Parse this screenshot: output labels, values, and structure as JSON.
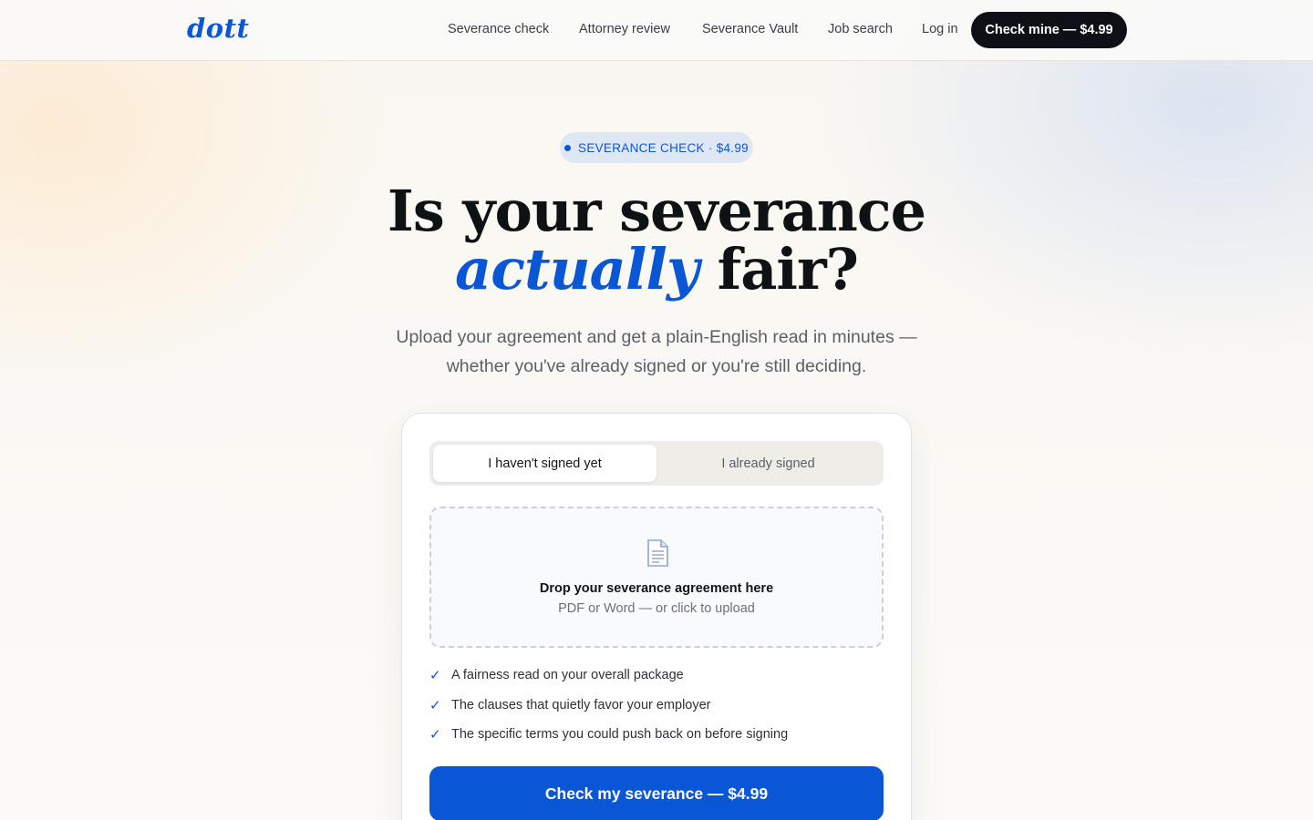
{
  "brand": {
    "logo": "dott"
  },
  "nav": {
    "links": [
      "Severance check",
      "Attorney review",
      "Severance Vault",
      "Job search",
      "Log in"
    ],
    "cta": "Check mine — $4.99"
  },
  "hero": {
    "pill": "SEVERANCE CHECK · $4.99",
    "title_line1": "Is your severance",
    "title_accent": "actually",
    "title_rest": "fair?",
    "subtitle": "Upload your agreement and get a plain-English read in minutes — whether you've already signed or you're still deciding."
  },
  "card": {
    "toggle": {
      "options": [
        "I haven't signed yet",
        "I already signed"
      ],
      "selected": 0
    },
    "dropzone": {
      "icon": "document-icon",
      "title": "Drop your severance agreement here",
      "subtitle": "PDF or Word — or click to upload"
    },
    "features": [
      "A fairness read on your overall package",
      "The clauses that quietly favor your employer",
      "The specific terms you could push back on before signing"
    ],
    "check_glyph": "✓",
    "cta": "Check my severance — $4.99"
  },
  "colors": {
    "accent": "#0a57d6",
    "dark": "#0d1117"
  }
}
